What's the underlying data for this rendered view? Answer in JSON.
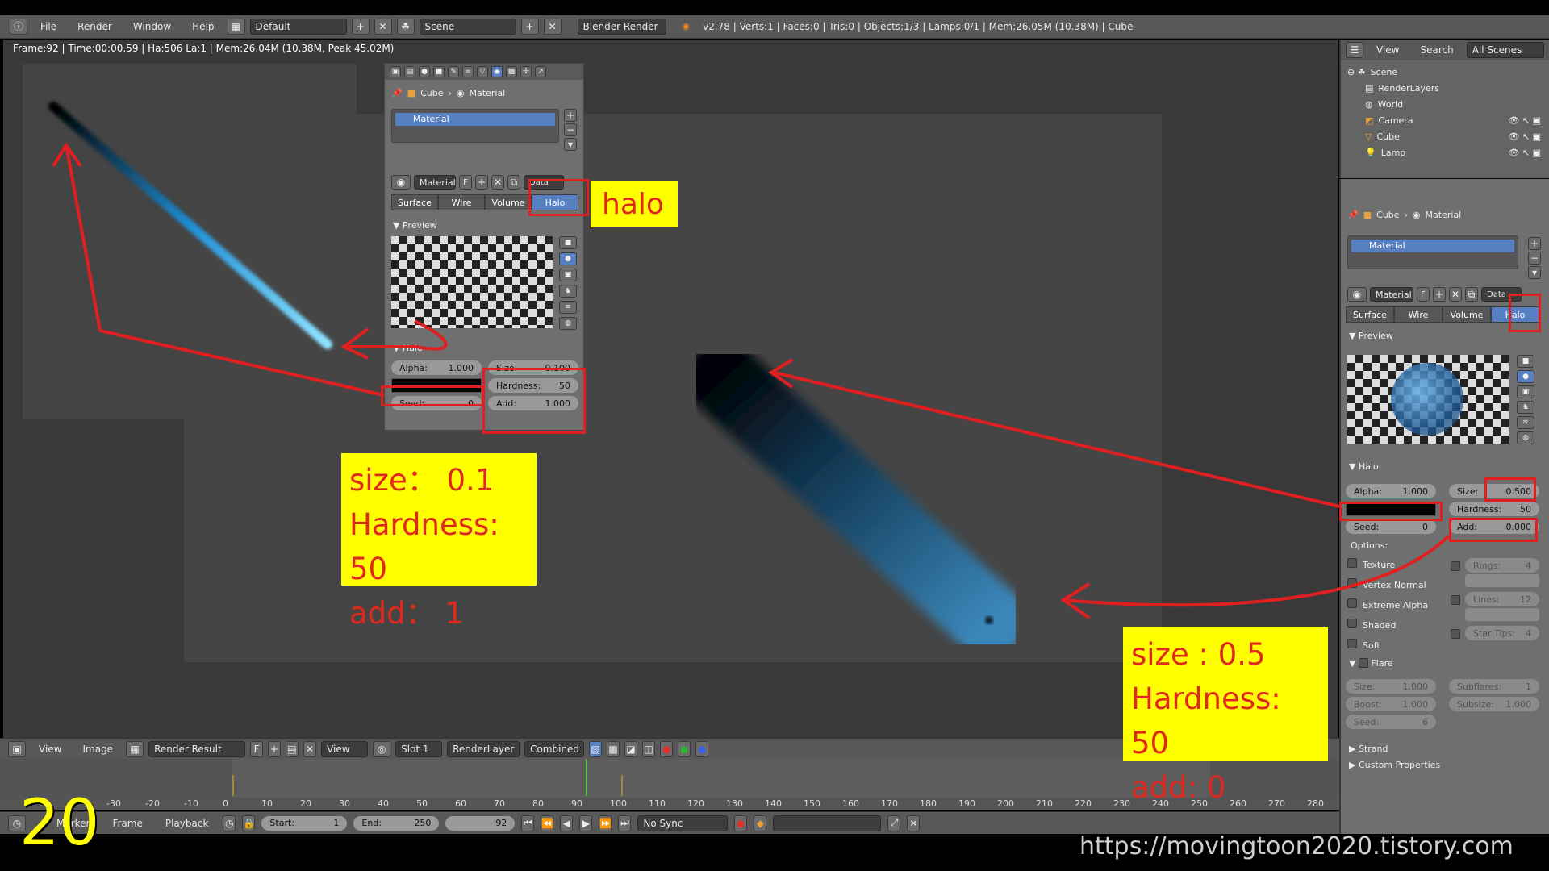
{
  "topbar": {
    "menus": [
      "File",
      "Render",
      "Window",
      "Help"
    ],
    "layout": "Default",
    "scene": "Scene",
    "engine": "Blender Render",
    "stats": "v2.78 | Verts:1 | Faces:0 | Tris:0 | Objects:1/3 | Lamps:0/1 | Mem:26.05M (10.38M) | Cube"
  },
  "viewport": {
    "frame_info": "Frame:92 | Time:00:00.59 | Ha:506 La:1 | Mem:26.04M (10.38M, Peak 45.02M)"
  },
  "matpanel": {
    "breadcrumb_object": "Cube",
    "breadcrumb_material": "Material",
    "slot_name": "Material",
    "datablock": "Material",
    "datablock_f": "F",
    "data_label": "Data",
    "tabs": [
      "Surface",
      "Wire",
      "Volume",
      "Halo"
    ],
    "preview_label": "Preview",
    "halo_label": "Halo",
    "alpha_label": "Alpha:",
    "alpha_value": "1.000",
    "seed_label": "Seed:",
    "seed_value": "0",
    "size_label": "Size:",
    "size_value": "0.100",
    "hardness_label": "Hardness:",
    "hardness_value": "50",
    "add_label": "Add:",
    "add_value": "1.000"
  },
  "outliner": {
    "menus": [
      "View",
      "Search"
    ],
    "filter": "All Scenes",
    "items": [
      "Scene",
      "RenderLayers",
      "World",
      "Camera",
      "Cube",
      "Lamp"
    ]
  },
  "props": {
    "breadcrumb_object": "Cube",
    "breadcrumb_material": "Material",
    "slot_name": "Material",
    "datablock": "Material",
    "datablock_f": "F",
    "data_label": "Data",
    "tabs": [
      "Surface",
      "Wire",
      "Volume",
      "Halo"
    ],
    "preview_label": "Preview",
    "halo_label": "Halo",
    "alpha_label": "Alpha:",
    "alpha_value": "1.000",
    "seed_label": "Seed:",
    "seed_value": "0",
    "size_label": "Size:",
    "size_value": "0.500",
    "hardness_label": "Hardness:",
    "hardness_value": "50",
    "add_label": "Add:",
    "add_value": "0.000",
    "options_label": "Options:",
    "options_left": [
      "Texture",
      "Vertex Normal",
      "Extreme Alpha",
      "Shaded",
      "Soft"
    ],
    "rings_label": "Rings:",
    "rings_value": "4",
    "lines_label": "Lines:",
    "lines_value": "12",
    "startips_label": "Star Tips:",
    "startips_value": "4",
    "flare_label": "Flare",
    "flare_size_label": "Size:",
    "flare_size_value": "1.000",
    "boost_label": "Boost:",
    "boost_value": "1.000",
    "flare_seed_label": "Seed:",
    "flare_seed_value": "6",
    "subflares_label": "Subflares:",
    "subflares_value": "1",
    "subsize_label": "Subsize:",
    "subsize_value": "1.000",
    "strand_label": "Strand",
    "custom_label": "Custom Properties"
  },
  "imgheader": {
    "menus": [
      "View",
      "Image"
    ],
    "image": "Render Result",
    "f": "F",
    "view": "View",
    "slot": "Slot 1",
    "layer": "RenderLayer",
    "pass": "Combined"
  },
  "timeline": {
    "ticks": [
      "-30",
      "-20",
      "-10",
      "0",
      "10",
      "20",
      "30",
      "40",
      "50",
      "60",
      "70",
      "80",
      "90",
      "100",
      "110",
      "120",
      "130",
      "140",
      "150",
      "160",
      "170",
      "180",
      "190",
      "200",
      "210",
      "220",
      "230",
      "240",
      "250",
      "260",
      "270",
      "280"
    ],
    "current_frame_value": 92,
    "footer_menus": [
      "Marker",
      "Frame",
      "Playback"
    ],
    "start_label": "Start:",
    "start_value": "1",
    "end_label": "End:",
    "end_value": "250",
    "current": "92",
    "sync": "No Sync"
  },
  "annotations": {
    "halo": "halo",
    "left_box": [
      "size： 0.1",
      "Hardness: 50",
      "add： 1"
    ],
    "right_box": [
      "size : 0.5",
      "Hardness: 50",
      "add:  0"
    ],
    "slide_number": "20",
    "watermark": "https://movingtoon2020.tistory.com"
  },
  "colors": {
    "selected_blue": "#5680c2",
    "annotation_yellow": "#ffff00",
    "annotation_red": "#e0291e",
    "halo_cyan": "#4fc3f7"
  }
}
